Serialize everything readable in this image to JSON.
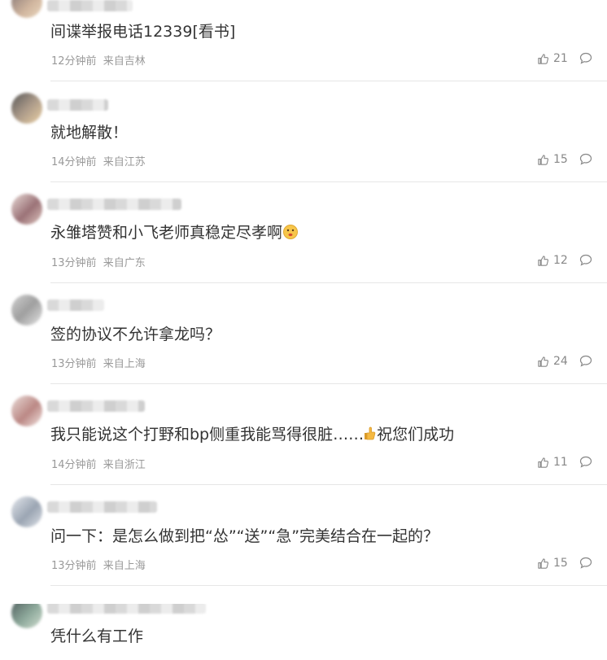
{
  "comments": [
    {
      "text": "间谍举报电话12339[看书]",
      "time": "12分钟前",
      "location": "来自吉林",
      "likes": "21"
    },
    {
      "text": "就地解散！",
      "time": "14分钟前",
      "location": "来自江苏",
      "likes": "15"
    },
    {
      "text": "永雏塔赞和小飞老师真稳定尽孝啊",
      "time": "13分钟前",
      "location": "来自广东",
      "likes": "12"
    },
    {
      "text": "签的协议不允许拿龙吗？",
      "time": "13分钟前",
      "location": "来自上海",
      "likes": "24"
    },
    {
      "text": "我只能说这个打野和bp侧重我能骂得很脏……",
      "text_after": "祝您们成功",
      "time": "14分钟前",
      "location": "来自浙江",
      "likes": "11"
    },
    {
      "text": "问一下：是怎么做到把“怂”“送”“急”完美结合在一起的？",
      "time": "13分钟前",
      "location": "来自上海",
      "likes": "15"
    },
    {
      "text": "凭什么有工作",
      "time": "",
      "location": "",
      "likes": ""
    }
  ],
  "icons": {
    "like": "thumbs-up-icon",
    "reply": "comment-bubble-icon",
    "emoji_thinking": "thinking-face-emoji",
    "emoji_thumb": "thumbs-up-emoji"
  }
}
